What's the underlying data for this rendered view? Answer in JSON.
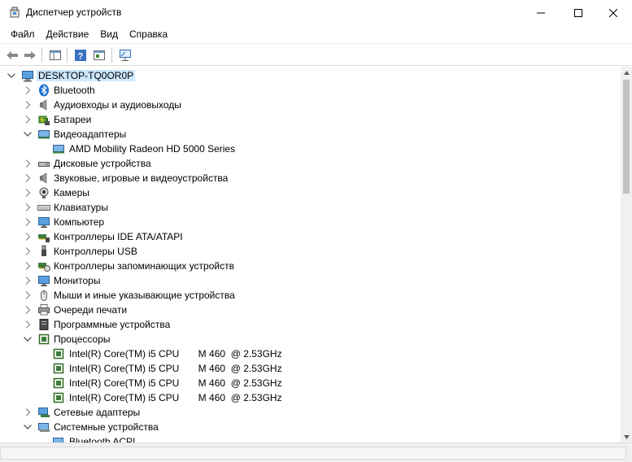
{
  "window": {
    "title": "Диспетчер устройств"
  },
  "menu": [
    "Файл",
    "Действие",
    "Вид",
    "Справка"
  ],
  "tree": {
    "root": "DESKTOP-TQ0OR0P",
    "items": [
      {
        "label": "Bluetooth",
        "icon": "bluetooth-icon",
        "expanded": false
      },
      {
        "label": "Аудиовходы и аудиовыходы",
        "icon": "speaker-icon",
        "expanded": false
      },
      {
        "label": "Батареи",
        "icon": "battery-icon",
        "expanded": false
      },
      {
        "label": "Видеоадаптеры",
        "icon": "display-adapter-icon",
        "expanded": true,
        "children": [
          "AMD Mobility Radeon HD 5000 Series"
        ]
      },
      {
        "label": "Дисковые устройства",
        "icon": "disk-drive-icon",
        "expanded": false
      },
      {
        "label": "Звуковые, игровые и видеоустройства",
        "icon": "speaker-icon",
        "expanded": false
      },
      {
        "label": "Камеры",
        "icon": "camera-icon",
        "expanded": false
      },
      {
        "label": "Клавиатуры",
        "icon": "keyboard-icon",
        "expanded": false
      },
      {
        "label": "Компьютер",
        "icon": "monitor-icon",
        "expanded": false
      },
      {
        "label": "Контроллеры IDE ATA/ATAPI",
        "icon": "ide-controller-icon",
        "expanded": false
      },
      {
        "label": "Контроллеры USB",
        "icon": "usb-icon",
        "expanded": false
      },
      {
        "label": "Контроллеры запоминающих устройств",
        "icon": "storage-controller-icon",
        "expanded": false
      },
      {
        "label": "Мониторы",
        "icon": "monitor-icon",
        "expanded": false
      },
      {
        "label": "Мыши и иные указывающие устройства",
        "icon": "mouse-icon",
        "expanded": false
      },
      {
        "label": "Очереди печати",
        "icon": "printer-icon",
        "expanded": false
      },
      {
        "label": "Программные устройства",
        "icon": "software-device-icon",
        "expanded": false
      },
      {
        "label": "Процессоры",
        "icon": "processor-icon",
        "expanded": true,
        "children": [
          "Intel(R) Core(TM) i5 CPU       M 460  @ 2.53GHz",
          "Intel(R) Core(TM) i5 CPU       M 460  @ 2.53GHz",
          "Intel(R) Core(TM) i5 CPU       M 460  @ 2.53GHz",
          "Intel(R) Core(TM) i5 CPU       M 460  @ 2.53GHz"
        ]
      },
      {
        "label": "Сетевые адаптеры",
        "icon": "network-adapter-icon",
        "expanded": false
      },
      {
        "label": "Системные устройства",
        "icon": "system-device-icon",
        "expanded": true,
        "children": [
          "Bluetooth ACPI"
        ]
      }
    ]
  },
  "colors": {
    "selection": "#cce8ff",
    "accent": "#0078d7"
  }
}
